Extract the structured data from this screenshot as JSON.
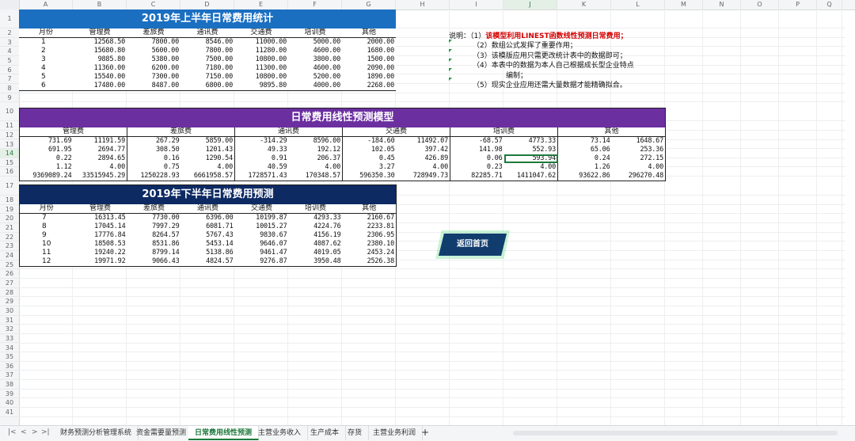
{
  "columns": [
    "A",
    "B",
    "C",
    "D",
    "E",
    "F",
    "G",
    "H",
    "I",
    "J",
    "K",
    "L",
    "M",
    "N",
    "O",
    "P",
    "Q"
  ],
  "rows": [
    "1",
    "2",
    "3",
    "4",
    "5",
    "6",
    "7",
    "8",
    "9",
    "10",
    "11",
    "12",
    "13",
    "14",
    "15",
    "16",
    "17",
    "18",
    "19",
    "20",
    "21",
    "22",
    "23",
    "24",
    "25",
    "26",
    "27",
    "28",
    "29",
    "30",
    "31",
    "32",
    "33",
    "34",
    "35",
    "36",
    "37",
    "38",
    "39",
    "40",
    "41"
  ],
  "selected_cell": {
    "col": "J",
    "row": "14"
  },
  "table1": {
    "title": "2019年上半年日常费用统计",
    "headers": [
      "月份",
      "管理费",
      "差旅费",
      "通讯费",
      "交通费",
      "培训费",
      "其他"
    ],
    "rows": [
      [
        "1",
        "12568.50",
        "7800.00",
        "8546.00",
        "11000.00",
        "5000.00",
        "2000.00"
      ],
      [
        "2",
        "15680.80",
        "5600.00",
        "7800.00",
        "11280.00",
        "4600.00",
        "1680.00"
      ],
      [
        "3",
        "9885.80",
        "5380.00",
        "7500.00",
        "10800.00",
        "3800.00",
        "1500.00"
      ],
      [
        "4",
        "11360.00",
        "6200.00",
        "7180.00",
        "11300.00",
        "4600.00",
        "2090.00"
      ],
      [
        "5",
        "15540.00",
        "7300.00",
        "7150.00",
        "10800.00",
        "5200.00",
        "1890.00"
      ],
      [
        "6",
        "17480.00",
        "8487.00",
        "6800.00",
        "9895.80",
        "4000.00",
        "2268.00"
      ]
    ]
  },
  "table2": {
    "title": "日常费用线性预测模型",
    "groups": [
      "管理费",
      "差旅费",
      "通讯费",
      "交通费",
      "培训费",
      "其他"
    ],
    "rows": [
      [
        "731.69",
        "11191.59",
        "267.29",
        "5859.00",
        "-314.29",
        "8596.00",
        "-184.60",
        "11492.07",
        "-68.57",
        "4773.33",
        "73.14",
        "1648.67"
      ],
      [
        "691.95",
        "2694.77",
        "308.50",
        "1201.43",
        "49.33",
        "192.12",
        "102.05",
        "397.42",
        "141.98",
        "552.93",
        "65.06",
        "253.36"
      ],
      [
        "0.22",
        "2894.65",
        "0.16",
        "1290.54",
        "0.91",
        "206.37",
        "0.45",
        "426.89",
        "0.06",
        "593.94",
        "0.24",
        "272.15"
      ],
      [
        "1.12",
        "4.00",
        "0.75",
        "4.00",
        "40.59",
        "4.00",
        "3.27",
        "4.00",
        "0.23",
        "4.00",
        "1.26",
        "4.00"
      ],
      [
        "9369089.24",
        "33515945.29",
        "1250228.93",
        "6661958.57",
        "1728571.43",
        "170348.57",
        "596350.30",
        "728949.73",
        "82285.71",
        "1411047.62",
        "93622.86",
        "296270.48"
      ]
    ]
  },
  "table3": {
    "title": "2019年下半年日常费用预测",
    "headers": [
      "月份",
      "管理费",
      "差旅费",
      "通讯费",
      "交通费",
      "培训费",
      "其他"
    ],
    "rows": [
      [
        "7",
        "16313.45",
        "7730.00",
        "6396.00",
        "10199.87",
        "4293.33",
        "2160.67"
      ],
      [
        "8",
        "17045.14",
        "7997.29",
        "6081.71",
        "10015.27",
        "4224.76",
        "2233.81"
      ],
      [
        "9",
        "17776.84",
        "8264.57",
        "5767.43",
        "9830.67",
        "4156.19",
        "2306.95"
      ],
      [
        "10",
        "18508.53",
        "8531.86",
        "5453.14",
        "9646.07",
        "4087.62",
        "2380.10"
      ],
      [
        "11",
        "19240.22",
        "8799.14",
        "5138.86",
        "9461.47",
        "4019.05",
        "2453.24"
      ],
      [
        "12",
        "19971.92",
        "9066.43",
        "4824.57",
        "9276.87",
        "3950.48",
        "2526.38"
      ]
    ]
  },
  "notes": {
    "label": "说明：",
    "n1_prefix": "（1）",
    "n1": "该模型利用LINEST函数线性预测日常费用；",
    "n2": "（2）数组公式发挥了重要作用；",
    "n3": "（3）该模版应用只需更改统计表中的数据即可；",
    "n4": "（4）本表中的数据为本人自己根据成长型企业特点",
    "n4b": "编制；",
    "n5": "（5）现实企业应用还需大量数据才能精确拟合。"
  },
  "home_button": "返回首页",
  "tabs": [
    "财务预测分析管理系统",
    "资金需要量预测",
    "日常费用线性预测",
    "主营业务收入",
    "生产成本",
    "存货",
    "主营业务利润"
  ],
  "active_tab": "日常费用线性预测",
  "nav_glyphs": [
    "|<",
    "<",
    ">",
    ">|"
  ],
  "add_tab": "+",
  "colors": {
    "t1": "#1b6fc1",
    "t2": "#6b2fa0",
    "t3": "#0d2a63",
    "accent": "#1e7a3c",
    "note_red": "#d40000"
  }
}
